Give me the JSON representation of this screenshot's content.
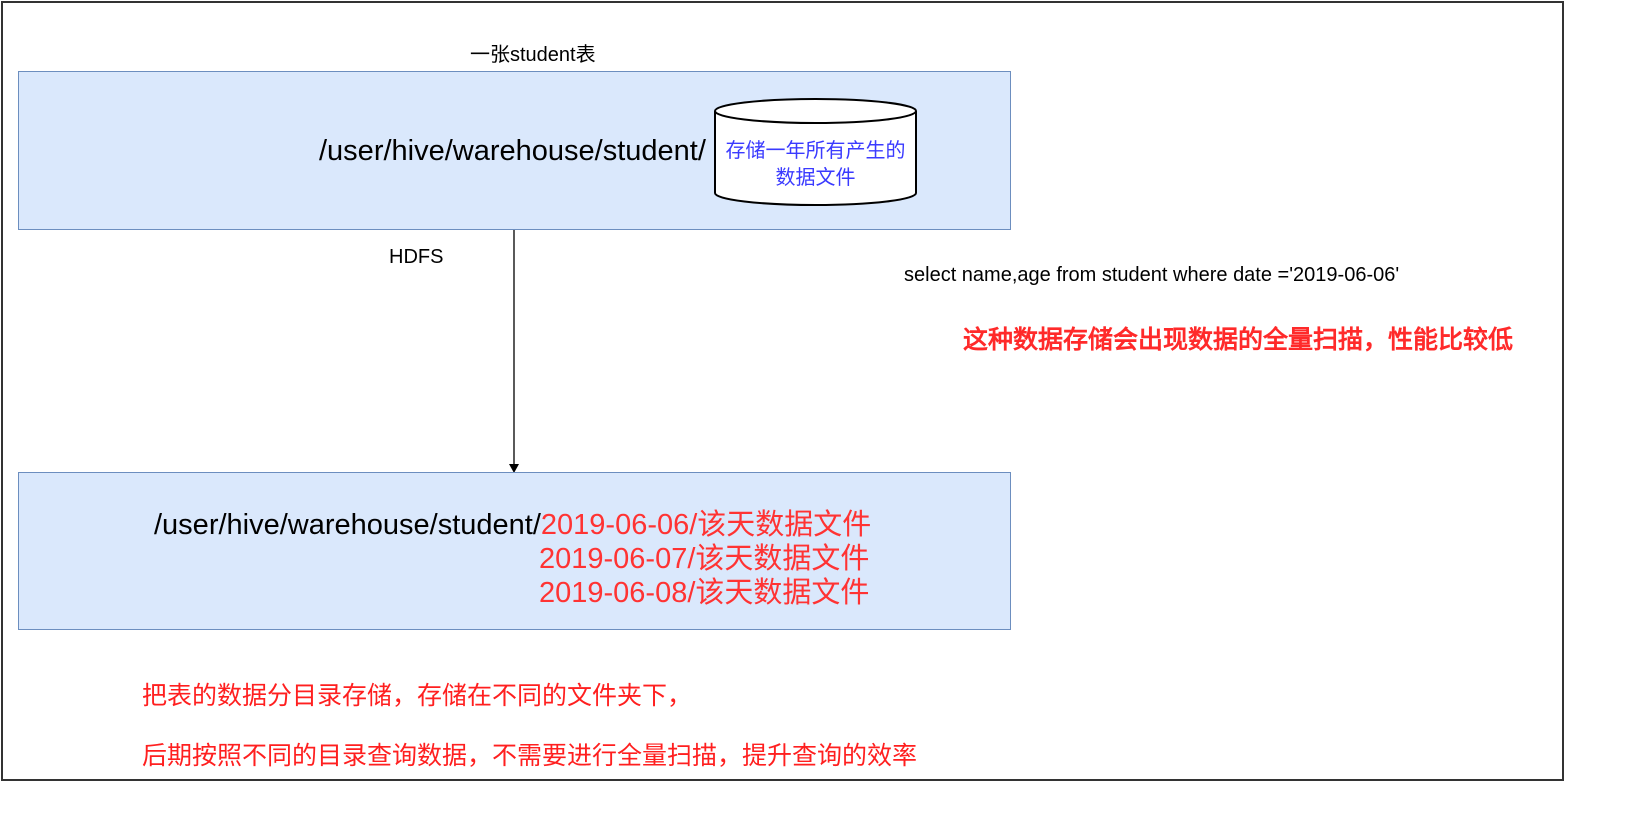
{
  "top": {
    "title": "一张student表",
    "path": "/user/hive/warehouse/student/",
    "storage_line1": "存储一年所有产生的",
    "storage_line2": "数据文件"
  },
  "connector": {
    "label": "HDFS"
  },
  "query": {
    "sql": "select name,age from student where date ='2019-06-06'",
    "warning": "这种数据存储会出现数据的全量扫描，性能比较低"
  },
  "bottom": {
    "path_prefix": "/user/hive/warehouse/student/",
    "partitions": [
      "2019-06-06/该天数据文件",
      "2019-06-07/该天数据文件",
      "2019-06-08/该天数据文件"
    ]
  },
  "notes": {
    "line1": "把表的数据分目录存储，存储在不同的文件夹下，",
    "line2": "后期按照不同的目录查询数据，不需要进行全量扫描，提升查询的效率"
  },
  "colors": {
    "box_fill": "#dae8fc",
    "box_stroke": "#6c8ebf",
    "cylinder_text": "#3a3aff",
    "highlight_red": "#ff3333"
  }
}
